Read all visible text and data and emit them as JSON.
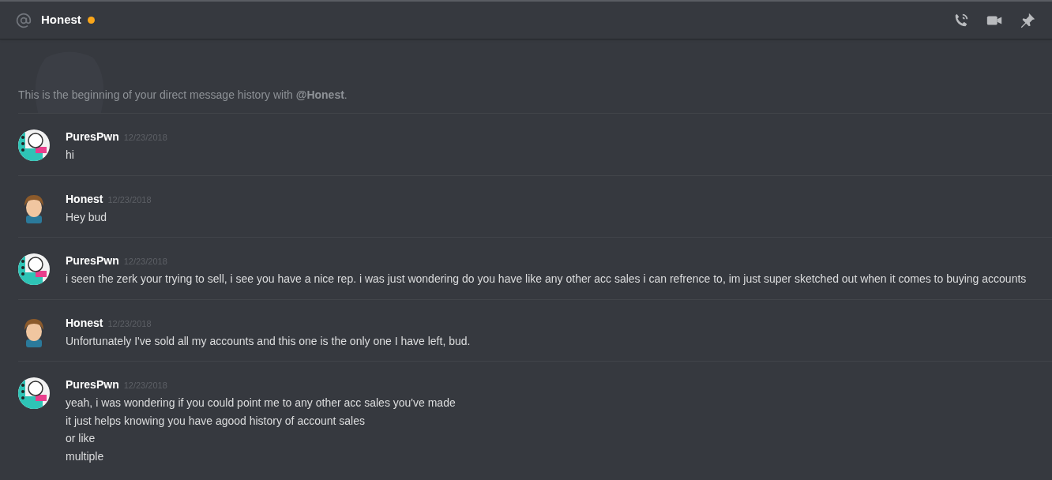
{
  "header": {
    "title": "Honest",
    "status": {
      "color": "#faa61a"
    }
  },
  "intro": "This is the beginning of your direct message history with **@Honest**.",
  "messages": [
    {
      "author": "PuresPwn",
      "date": "12/23/2018",
      "avatar": {
        "kind": "logo"
      },
      "lines": [
        "hi"
      ]
    },
    {
      "author": "Honest",
      "date": "12/23/2018",
      "avatar": {
        "kind": "figure"
      },
      "lines": [
        "Hey bud"
      ]
    },
    {
      "author": "PuresPwn",
      "date": "12/23/2018",
      "avatar": {
        "kind": "logo"
      },
      "lines": [
        "i seen the zerk your trying to sell, i see you have a nice rep. i was just wondering do you have like any other acc sales i can refrence to, im just super sketched out when it comes to buying accounts"
      ]
    },
    {
      "author": "Honest",
      "date": "12/23/2018",
      "avatar": {
        "kind": "figure"
      },
      "lines": [
        "Unfortunately I've sold all my accounts and this one is the only one I have left, bud."
      ]
    },
    {
      "author": "PuresPwn",
      "date": "12/23/2018",
      "avatar": {
        "kind": "logo"
      },
      "lines": [
        "yeah, i was wondering if you could point me to any other acc sales you've made",
        "it just helps knowing you have agood history of account sales",
        "or like",
        "multiple"
      ]
    }
  ]
}
